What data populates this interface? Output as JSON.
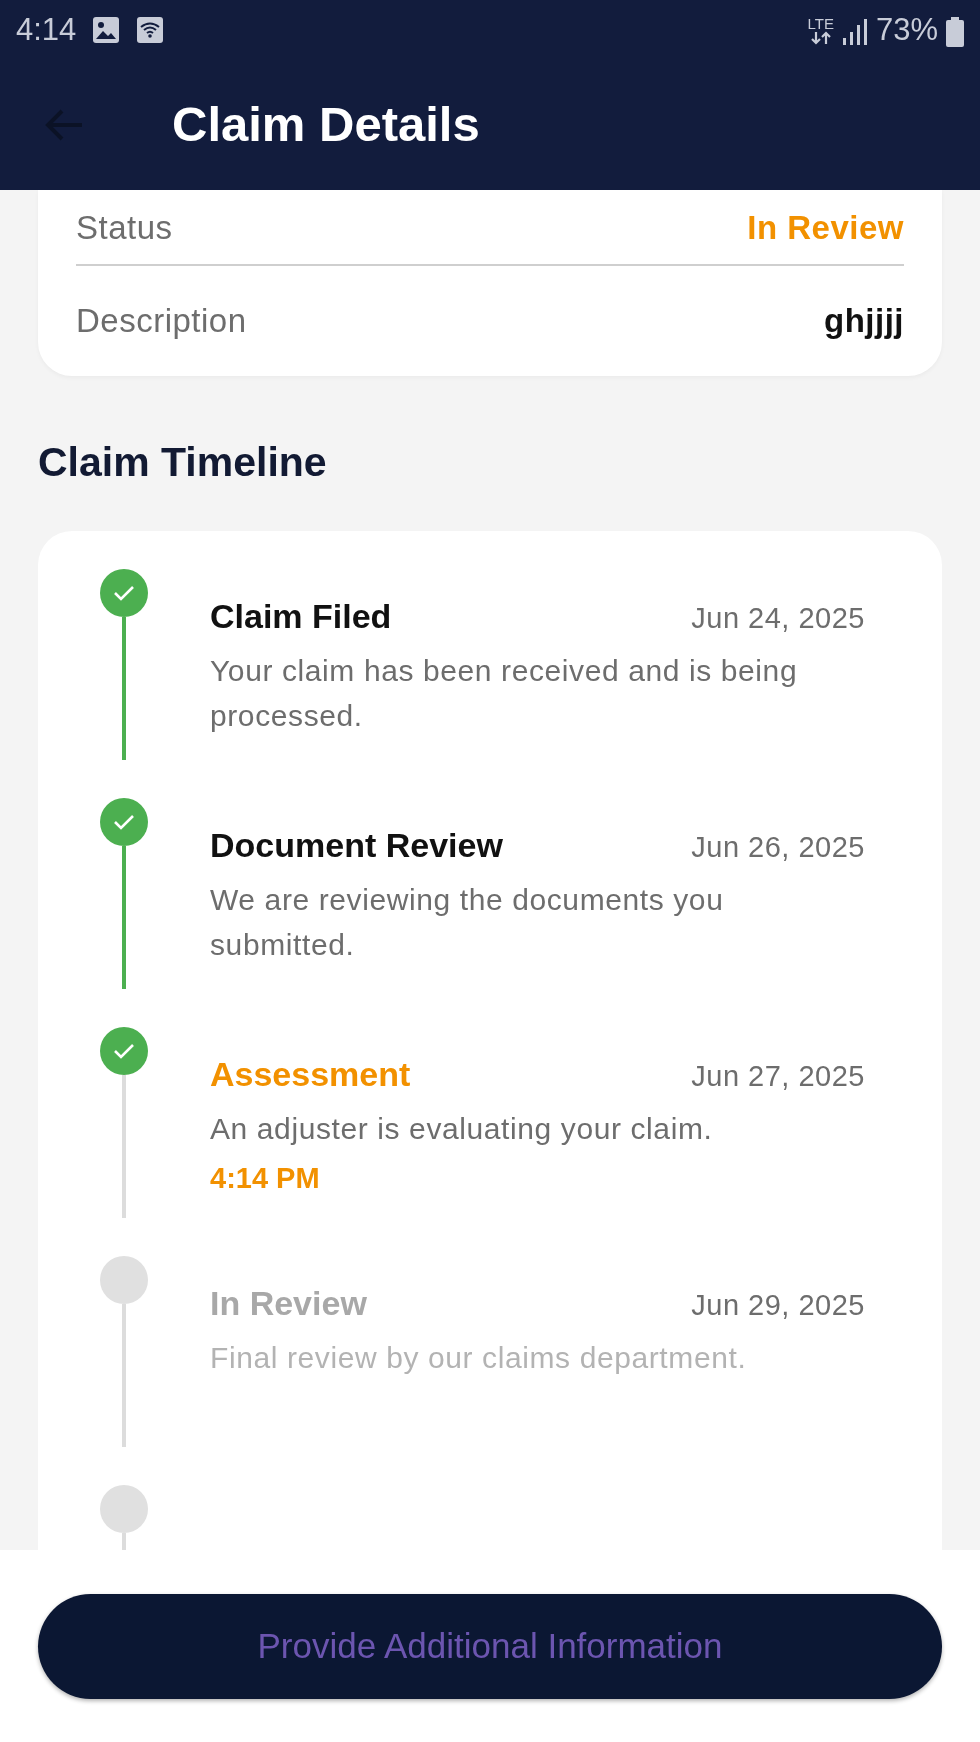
{
  "status_bar": {
    "time": "4:14",
    "network": "LTE",
    "battery": "73%"
  },
  "app_bar": {
    "title": "Claim Details"
  },
  "details": [
    {
      "label": "Status",
      "value": "In Review",
      "kind": "status"
    },
    {
      "label": "Description",
      "value": "ghjjjj",
      "kind": "plain"
    }
  ],
  "timeline": {
    "title": "Claim Timeline",
    "steps": [
      {
        "title": "Claim Filed",
        "date": "Jun 24, 2025",
        "description": "Your claim has been received and is being processed.",
        "kind": "completed"
      },
      {
        "title": "Document Review",
        "date": "Jun 26, 2025",
        "description": "We are reviewing the documents you submitted.",
        "kind": "completed"
      },
      {
        "title": "Assessment",
        "date": "Jun 27, 2025",
        "description": "An adjuster is evaluating your claim.",
        "time": "4:14 PM",
        "kind": "current"
      },
      {
        "title": "In Review",
        "date": "Jun 29, 2025",
        "description": "Final review by our claims department.",
        "kind": "pending"
      },
      {
        "kind": "pending"
      }
    ]
  },
  "action_button": {
    "label": "Provide Additional Information"
  }
}
